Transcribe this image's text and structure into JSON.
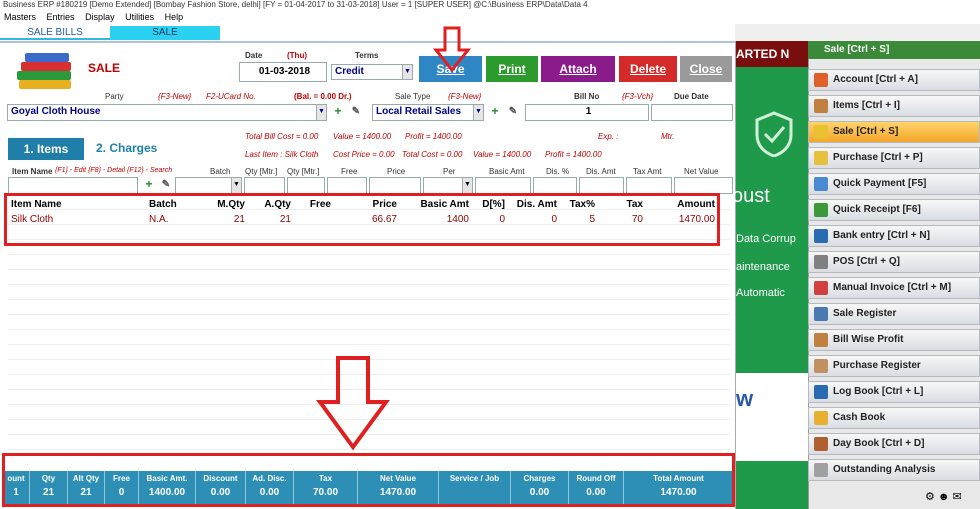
{
  "window": {
    "title": "Business ERP #180219 [Demo Extended] [Bombay Fashion Store, delhi] [FY = 01-04-2017 to 31-03-2018] User = 1 [SUPER USER] @C:\\Business ERP\\Data\\Data 4"
  },
  "menu": [
    "Masters",
    "Entries",
    "Display",
    "Utilities",
    "Help"
  ],
  "tabs": [
    {
      "label": "SALE BILLS"
    },
    {
      "label": "SALE"
    }
  ],
  "form": {
    "heading": "SALE",
    "date_label": "Date",
    "date_day": "(Thu)",
    "date_value": "01-03-2018",
    "terms_label": "Terms",
    "terms_value": "Credit",
    "party_label": "Party",
    "party_hint": "{F3-New}",
    "ucard_hint": "F2-UCard No.",
    "balance": "(Bal. = 0.00 Dr.)",
    "party_value": "Goyal Cloth House",
    "saletype_label": "Sale Type",
    "saletype_hint": "{F3-New}",
    "saletype_value": "Local Retail Sales",
    "billno_label": "Bill No",
    "billno_hint": "{F3-Vch}",
    "billno_value": "1",
    "duedate_label": "Due Date"
  },
  "buttons": {
    "save": "Save",
    "print": "Print",
    "attach": "Attach",
    "delete": "Delete",
    "close": "Close"
  },
  "colors": {
    "save": "#2f86c4",
    "print": "#2c9a2c",
    "attach": "#8b1a8b",
    "delete": "#d42a2a",
    "close": "#9a9a9a",
    "footer": "#2e8fb6",
    "highlight": "#e02020"
  },
  "subtabs": {
    "items": "1. Items",
    "charges": "2. Charges"
  },
  "summary": {
    "total_bill_cost": "Total Bill Cost = 0.00",
    "value": "Value = 1400.00",
    "profit": "Profit = 1400.00",
    "last_item": "Last Item : Silk Cloth",
    "cost_price": "Cost Price = 0.00",
    "total_cost": "Total Cost = 0.00",
    "last_value": "Value = 1400.00",
    "last_profit": "Profit = 1400.00",
    "exp_label": "Exp. :",
    "mtr_label": "Mtr."
  },
  "entry_header": {
    "item_name": "Item Name",
    "item_hint": "{F1} - Edit  {F8} - Detail  {F12} - Search",
    "batch": "Batch",
    "qty_mtr": "Qty [Mtr.]",
    "qty_mtr2": "Qty [Mtr.]",
    "free": "Free",
    "price": "Price",
    "per": "Per",
    "basic_amt": "Basic Amt",
    "dis_pct": "Dis. %",
    "dis_amt": "Dis. Amt",
    "tax_amt": "Tax Amt",
    "net_value": "Net Value"
  },
  "grid": {
    "headers": [
      "Item Name",
      "Batch",
      "M.Qty",
      "A.Qty",
      "Free",
      "Price",
      "Basic Amt",
      "D[%]",
      "Dis. Amt",
      "Tax%",
      "Tax",
      "Amount"
    ],
    "rows": [
      [
        "Silk Cloth",
        "N.A.",
        "21",
        "21",
        "",
        "66.67",
        "1400",
        "0",
        "0",
        "5",
        "70",
        "1470.00"
      ]
    ]
  },
  "footer": [
    {
      "label": "ount",
      "value": "1"
    },
    {
      "label": "Qty",
      "value": "21"
    },
    {
      "label": "Alt Qty",
      "value": "21"
    },
    {
      "label": "Free",
      "value": "0"
    },
    {
      "label": "Basic Amt.",
      "value": "1400.00"
    },
    {
      "label": "Discount",
      "value": "0.00"
    },
    {
      "label": "Ad. Disc.",
      "value": "0.00"
    },
    {
      "label": "Tax",
      "value": "70.00"
    },
    {
      "label": "Net Value",
      "value": "1470.00"
    },
    {
      "label": "Service / Job",
      "value": ""
    },
    {
      "label": "Charges",
      "value": "0.00"
    },
    {
      "label": "Round Off",
      "value": "0.00"
    },
    {
      "label": "Total Amount",
      "value": "1470.00"
    }
  ],
  "ad": {
    "top": "ARTED N",
    "line1": "oust",
    "line2": "Data Corrup",
    "line3": "aintenance",
    "line4": "Automatic",
    "logo": "w"
  },
  "right_panel": {
    "title": "Sale [Ctrl + S]",
    "items": [
      {
        "label": "Account [Ctrl + A]",
        "icon": "account-icon"
      },
      {
        "label": "Items [Ctrl + I]",
        "icon": "items-icon"
      },
      {
        "label": "Sale [Ctrl + S]",
        "icon": "sale-icon"
      },
      {
        "label": "Purchase [Ctrl + P]",
        "icon": "purchase-icon"
      },
      {
        "label": "Quick Payment [F5]",
        "icon": "payment-icon"
      },
      {
        "label": "Quick Receipt [F6]",
        "icon": "receipt-icon"
      },
      {
        "label": "Bank entry [Ctrl + N]",
        "icon": "bank-icon"
      },
      {
        "label": "POS [Ctrl + Q]",
        "icon": "pos-icon"
      },
      {
        "label": "Manual Invoice [Ctrl + M]",
        "icon": "invoice-icon"
      },
      {
        "label": "Sale Register",
        "icon": "register-icon"
      },
      {
        "label": "Bill Wise Profit",
        "icon": "profit-icon"
      },
      {
        "label": "Purchase Register",
        "icon": "register-icon"
      },
      {
        "label": "Log Book [Ctrl + L]",
        "icon": "logbook-icon"
      },
      {
        "label": "Cash Book",
        "icon": "cashbook-icon"
      },
      {
        "label": "Day Book [Ctrl + D]",
        "icon": "daybook-icon"
      },
      {
        "label": "Outstanding Analysis",
        "icon": "analysis-icon"
      }
    ]
  }
}
